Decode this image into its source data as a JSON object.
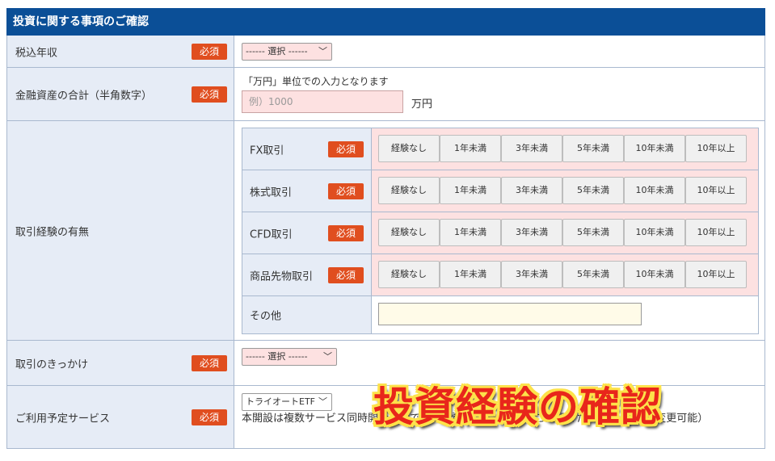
{
  "header": {
    "title": "投資に関する事項のご確認"
  },
  "required_label": "必須",
  "income": {
    "label": "税込年収",
    "select": "------ 選択 ------"
  },
  "assets": {
    "label": "金融資産の合計（半角数字）",
    "note": "「万円」単位での入力となります",
    "placeholder": "例）1000",
    "unit": "万円"
  },
  "experience": {
    "label": "取引経験の有無",
    "options": [
      "経験なし",
      "1年未満",
      "3年未満",
      "5年未満",
      "10年未満",
      "10年以上"
    ],
    "rows": [
      {
        "label": "FX取引"
      },
      {
        "label": "株式取引"
      },
      {
        "label": "CFD取引"
      },
      {
        "label": "商品先物取引"
      }
    ],
    "other_label": "その他"
  },
  "trigger": {
    "label": "取引のきっかけ",
    "select": "------ 選択 ------"
  },
  "service": {
    "label": "ご利用予定サービス",
    "select": "トライオートETF",
    "note": "本開設は複数サービス同時開設可能です。ご希望のサービスをご選択ください。（開設後変更可能）"
  },
  "overlay_text": "投資経験の確認",
  "colors": {
    "header_bg": "#0b4f97",
    "label_bg": "#e6ecf6",
    "required_bg": "#e04e1f",
    "input_bg": "#fde1e1"
  }
}
